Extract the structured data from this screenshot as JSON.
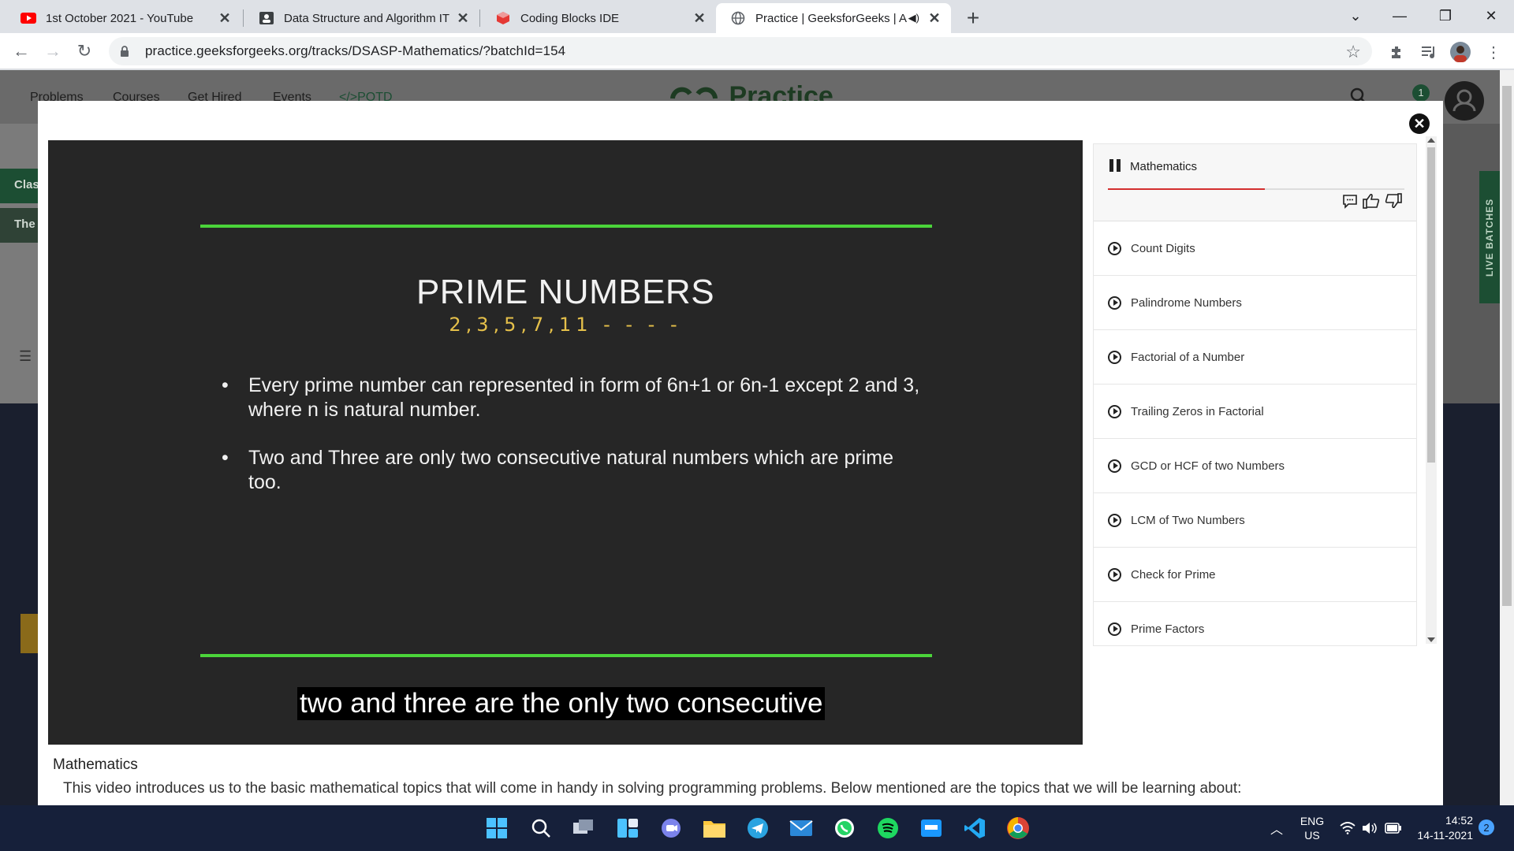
{
  "browser": {
    "tabs": [
      {
        "title": "1st October 2021 - YouTube",
        "icon": "youtube-icon"
      },
      {
        "title": "Data Structure and Algorithm IT",
        "icon": "classroom-icon"
      },
      {
        "title": "Coding Blocks IDE",
        "icon": "coding-blocks-icon"
      },
      {
        "title": "Practice | GeeksforGeeks | A c",
        "icon": "globe-icon",
        "active": true
      }
    ],
    "url": "practice.geeksforgeeks.org/tracks/DSASP-Mathematics/?batchId=154"
  },
  "site": {
    "nav": [
      "Problems",
      "Courses",
      "Get Hired",
      "Events",
      "</>POTD"
    ],
    "brand": "Practice",
    "notification_count": "1",
    "left_labels": [
      "Clas",
      "The"
    ],
    "live_batches": "LIVE BATCHES"
  },
  "video": {
    "slide_title": "PRIME NUMBERS",
    "handwriting": "2,3,5,7,11 - - - -",
    "bullets": [
      "Every prime number can represented in form of 6n+1 or 6n-1 except 2 and 3, where n is natural number.",
      "Two and Three are only two consecutive natural numbers which are prime too."
    ],
    "caption": "two and three are the only two consecutive"
  },
  "playlist": {
    "title": "Mathematics",
    "progress": 0.53,
    "items": [
      "Count Digits",
      "Palindrome Numbers",
      "Factorial of a Number",
      "Trailing Zeros in Factorial",
      "GCD or HCF of two Numbers",
      "LCM of Two Numbers",
      "Check for Prime",
      "Prime Factors"
    ]
  },
  "description": {
    "title": "Mathematics",
    "text": "This video introduces us to the basic mathematical topics that will come in handy in solving programming problems. Below mentioned are the topics that we will be learning about:"
  },
  "taskbar": {
    "lang": "ENG",
    "region": "US",
    "time": "14:52",
    "date": "14-11-2021",
    "notifications": "2"
  },
  "colors": {
    "accent_green": "#4bd43a",
    "progress_red": "#d32f2f",
    "handwriting": "#e5c04a"
  }
}
